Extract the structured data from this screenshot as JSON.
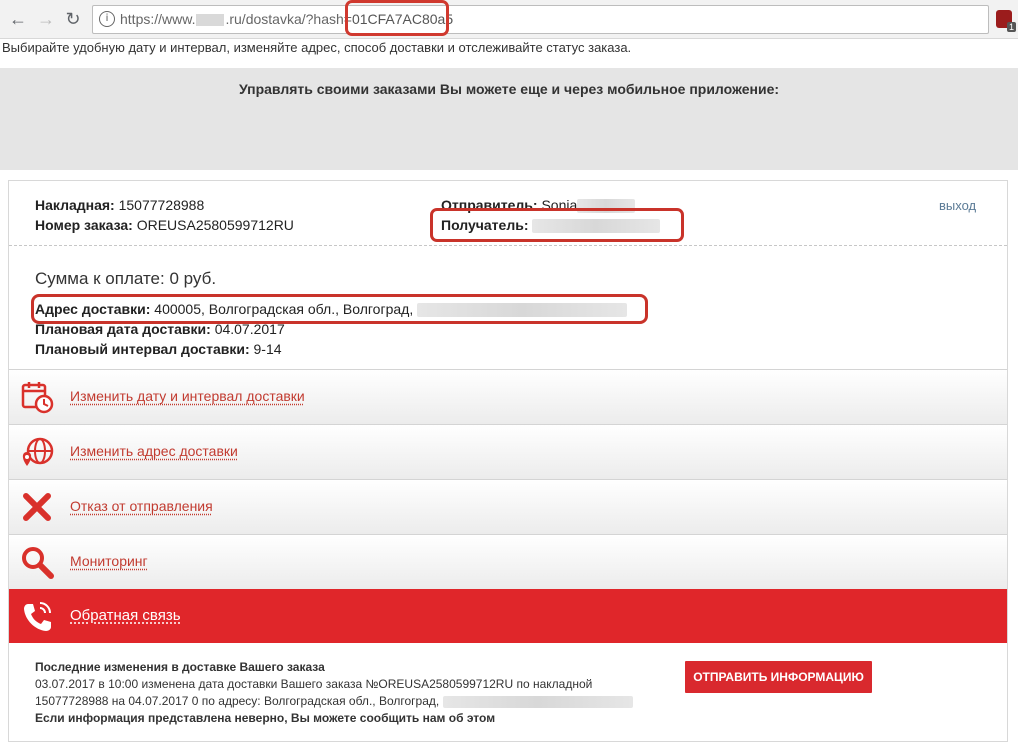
{
  "browser": {
    "url_prefix": "https://www.",
    "url_suffix": ".ru/dostavka/?hash=",
    "url_hash": "01CFA7AC80a5",
    "ext_badge": "1"
  },
  "intro_text": "Выбирайте удобную дату и интервал, изменяйте адрес, способ доставки и отслеживайте статус заказа.",
  "banner_text": "Управлять своими заказами Вы можете еще и через мобильное приложение:",
  "order": {
    "waybill_label": "Накладная:",
    "waybill_value": "15077728988",
    "order_label": "Номер заказа:",
    "order_value": "OREUSA2580599712RU",
    "sender_label": "Отправитель:",
    "sender_value": "Sonia",
    "recipient_label": "Получатель:",
    "logout": "выход"
  },
  "details": {
    "sum": "Сумма к оплате: 0 руб.",
    "address_label": "Адрес доставки:",
    "address_value": "400005, Волгоградская обл., Волгоград,",
    "date_label": "Плановая дата доставки:",
    "date_value": "04.07.2017",
    "interval_label": "Плановый интервал доставки:",
    "interval_value": "9-14"
  },
  "actions": [
    {
      "label": "Изменить дату и интервал доставки",
      "icon": "calendar-clock-icon"
    },
    {
      "label": "Изменить адрес доставки",
      "icon": "globe-pin-icon"
    },
    {
      "label": "Отказ от отправления",
      "icon": "cross-icon"
    },
    {
      "label": "Мониторинг",
      "icon": "magnifier-icon"
    },
    {
      "label": "Обратная связь",
      "icon": "phone-icon"
    }
  ],
  "changes": {
    "title": "Последние изменения в доставке Вашего заказа",
    "line1": "03.07.2017 в 10:00 изменена дата доставки Вашего заказа №OREUSA2580599712RU по накладной",
    "line2": "15077728988 на 04.07.2017 0 по адресу: Волгоградская обл., Волгоград,",
    "footer": "Если информация представлена неверно, Вы можете сообщить нам об этом"
  },
  "send_button": "ОТПРАВИТЬ ИНФОРМАЦИЮ",
  "colors": {
    "accent": "#e0262a",
    "highlight": "#c9332a",
    "link": "#c23b30"
  }
}
